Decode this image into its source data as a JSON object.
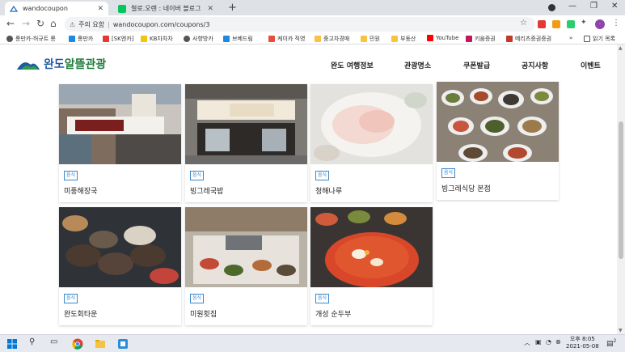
{
  "browser": {
    "tabs": [
      {
        "title": "wandocoupon",
        "active": true
      },
      {
        "title": "철로.오렌 : 네이버 블로그",
        "active": false
      }
    ],
    "url": {
      "warning": "주의 요함",
      "address": "wandocoupon.com/coupons/3"
    },
    "bookmarks": [
      "롱만카-허규트 롱",
      "롱만카",
      "[SK엔카]",
      "KB차차차",
      "사향방카",
      "브베드림",
      "케이카 직영",
      "중고차경매",
      "민원",
      "부동산",
      "YouTube",
      "키움증권",
      "메리츠증권증권"
    ],
    "bookmarks_more": "»",
    "reading_list": "읽기 목록"
  },
  "site": {
    "logo": {
      "part1": "완도",
      "part2": "알뜰관광"
    },
    "nav": [
      "완도 여행정보",
      "관광명소",
      "쿠폰발급",
      "공지사항",
      "이벤트"
    ]
  },
  "cards": [
    {
      "category": "음식",
      "title": "미풍해장국"
    },
    {
      "category": "음식",
      "title": "빙그레국밥"
    },
    {
      "category": "음식",
      "title": "청해나루"
    },
    {
      "category": "음식",
      "title": "빙그레식당 본점"
    },
    {
      "category": "음식",
      "title": "완도회타운"
    },
    {
      "category": "음식",
      "title": "미원횟집"
    },
    {
      "category": "음식",
      "title": "개성 순두부"
    }
  ],
  "taskbar": {
    "time": "오후 8:05",
    "date": "2021-05-08",
    "notifications": "2"
  }
}
